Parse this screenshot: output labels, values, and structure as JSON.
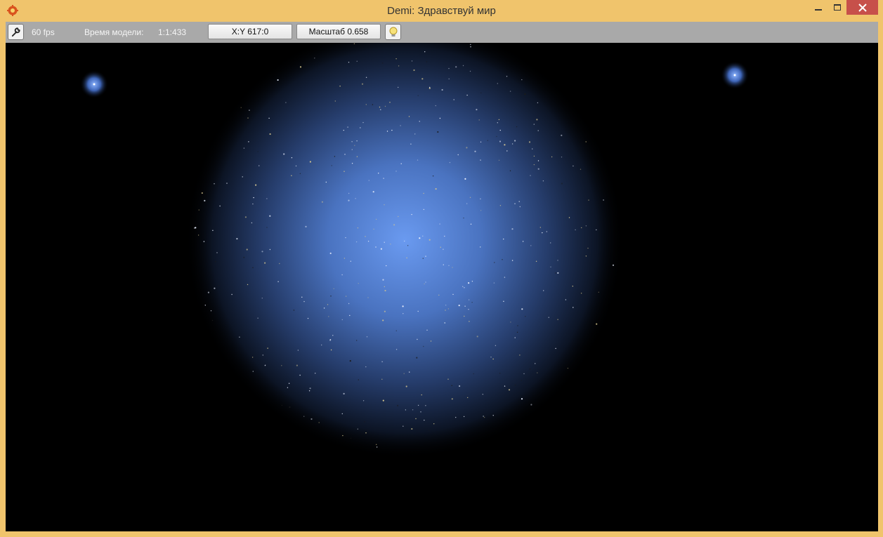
{
  "window": {
    "title": "Demi: Здравствуй мир",
    "icon": "gear-icon"
  },
  "toolbar": {
    "settings_icon": "wrench-icon",
    "fps": "60 fps",
    "time_label": "Время модели:",
    "time_value": "1:1:433",
    "xy_button": "X:Y 617:0",
    "scale_button": "Масштаб 0.658",
    "light_icon": "lightbulb-icon"
  },
  "colors": {
    "frame": "#f0c46c",
    "toolbar": "#a9a9a9",
    "close_button": "#c7504a",
    "space": "#000000",
    "glow": "#5a8ad8"
  }
}
